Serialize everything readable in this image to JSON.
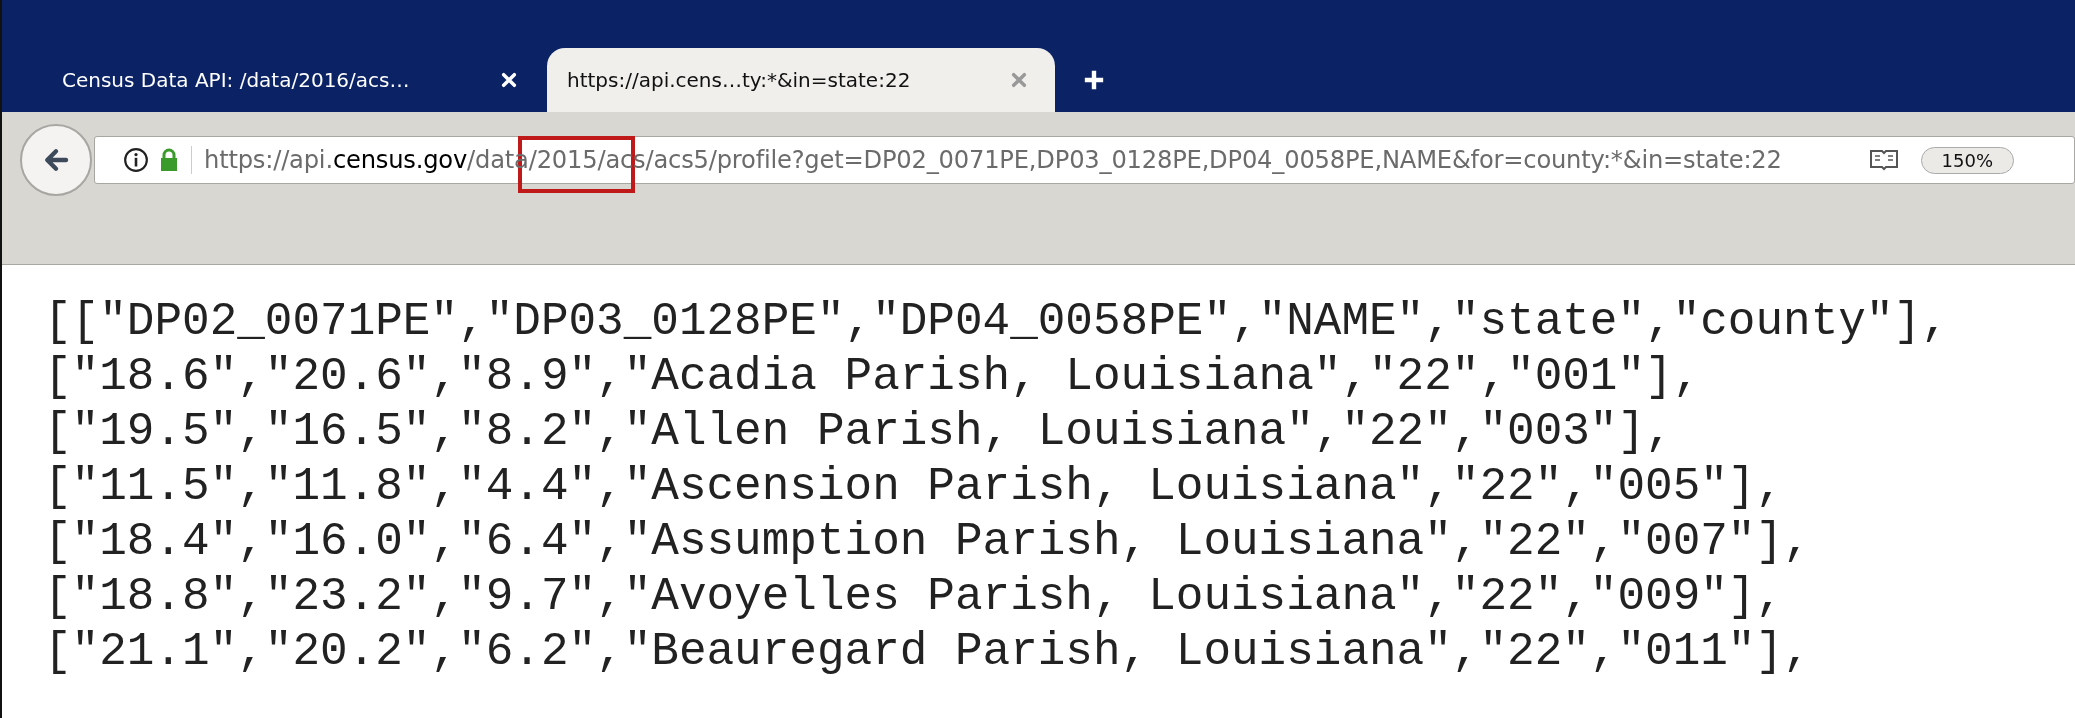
{
  "tabs": [
    {
      "title": "Census Data API: /data/2016/acs…",
      "selected": false
    },
    {
      "title": "https://api.cens…ty:*&in=state:22",
      "selected": true
    }
  ],
  "address_bar": {
    "url": "https://api.**census.gov**/data/2015/acs/acs5/profile?get=DP02_0071PE,DP03_0128PE,DP04_0058PE,NAME&for=county:*&in=state:22",
    "zoom": "150%"
  },
  "content": {
    "lines": [
      "[[\"DP02_0071PE\",\"DP03_0128PE\",\"DP04_0058PE\",\"NAME\",\"state\",\"county\"],",
      "[\"18.6\",\"20.6\",\"8.9\",\"Acadia Parish, Louisiana\",\"22\",\"001\"],",
      "[\"19.5\",\"16.5\",\"8.2\",\"Allen Parish, Louisiana\",\"22\",\"003\"],",
      "[\"11.5\",\"11.8\",\"4.4\",\"Ascension Parish, Louisiana\",\"22\",\"005\"],",
      "[\"18.4\",\"16.0\",\"6.4\",\"Assumption Parish, Louisiana\",\"22\",\"007\"],",
      "[\"18.8\",\"23.2\",\"9.7\",\"Avoyelles Parish, Louisiana\",\"22\",\"009\"],",
      "[\"21.1\",\"20.2\",\"6.2\",\"Beauregard Parish, Louisiana\",\"22\",\"011\"],"
    ]
  }
}
